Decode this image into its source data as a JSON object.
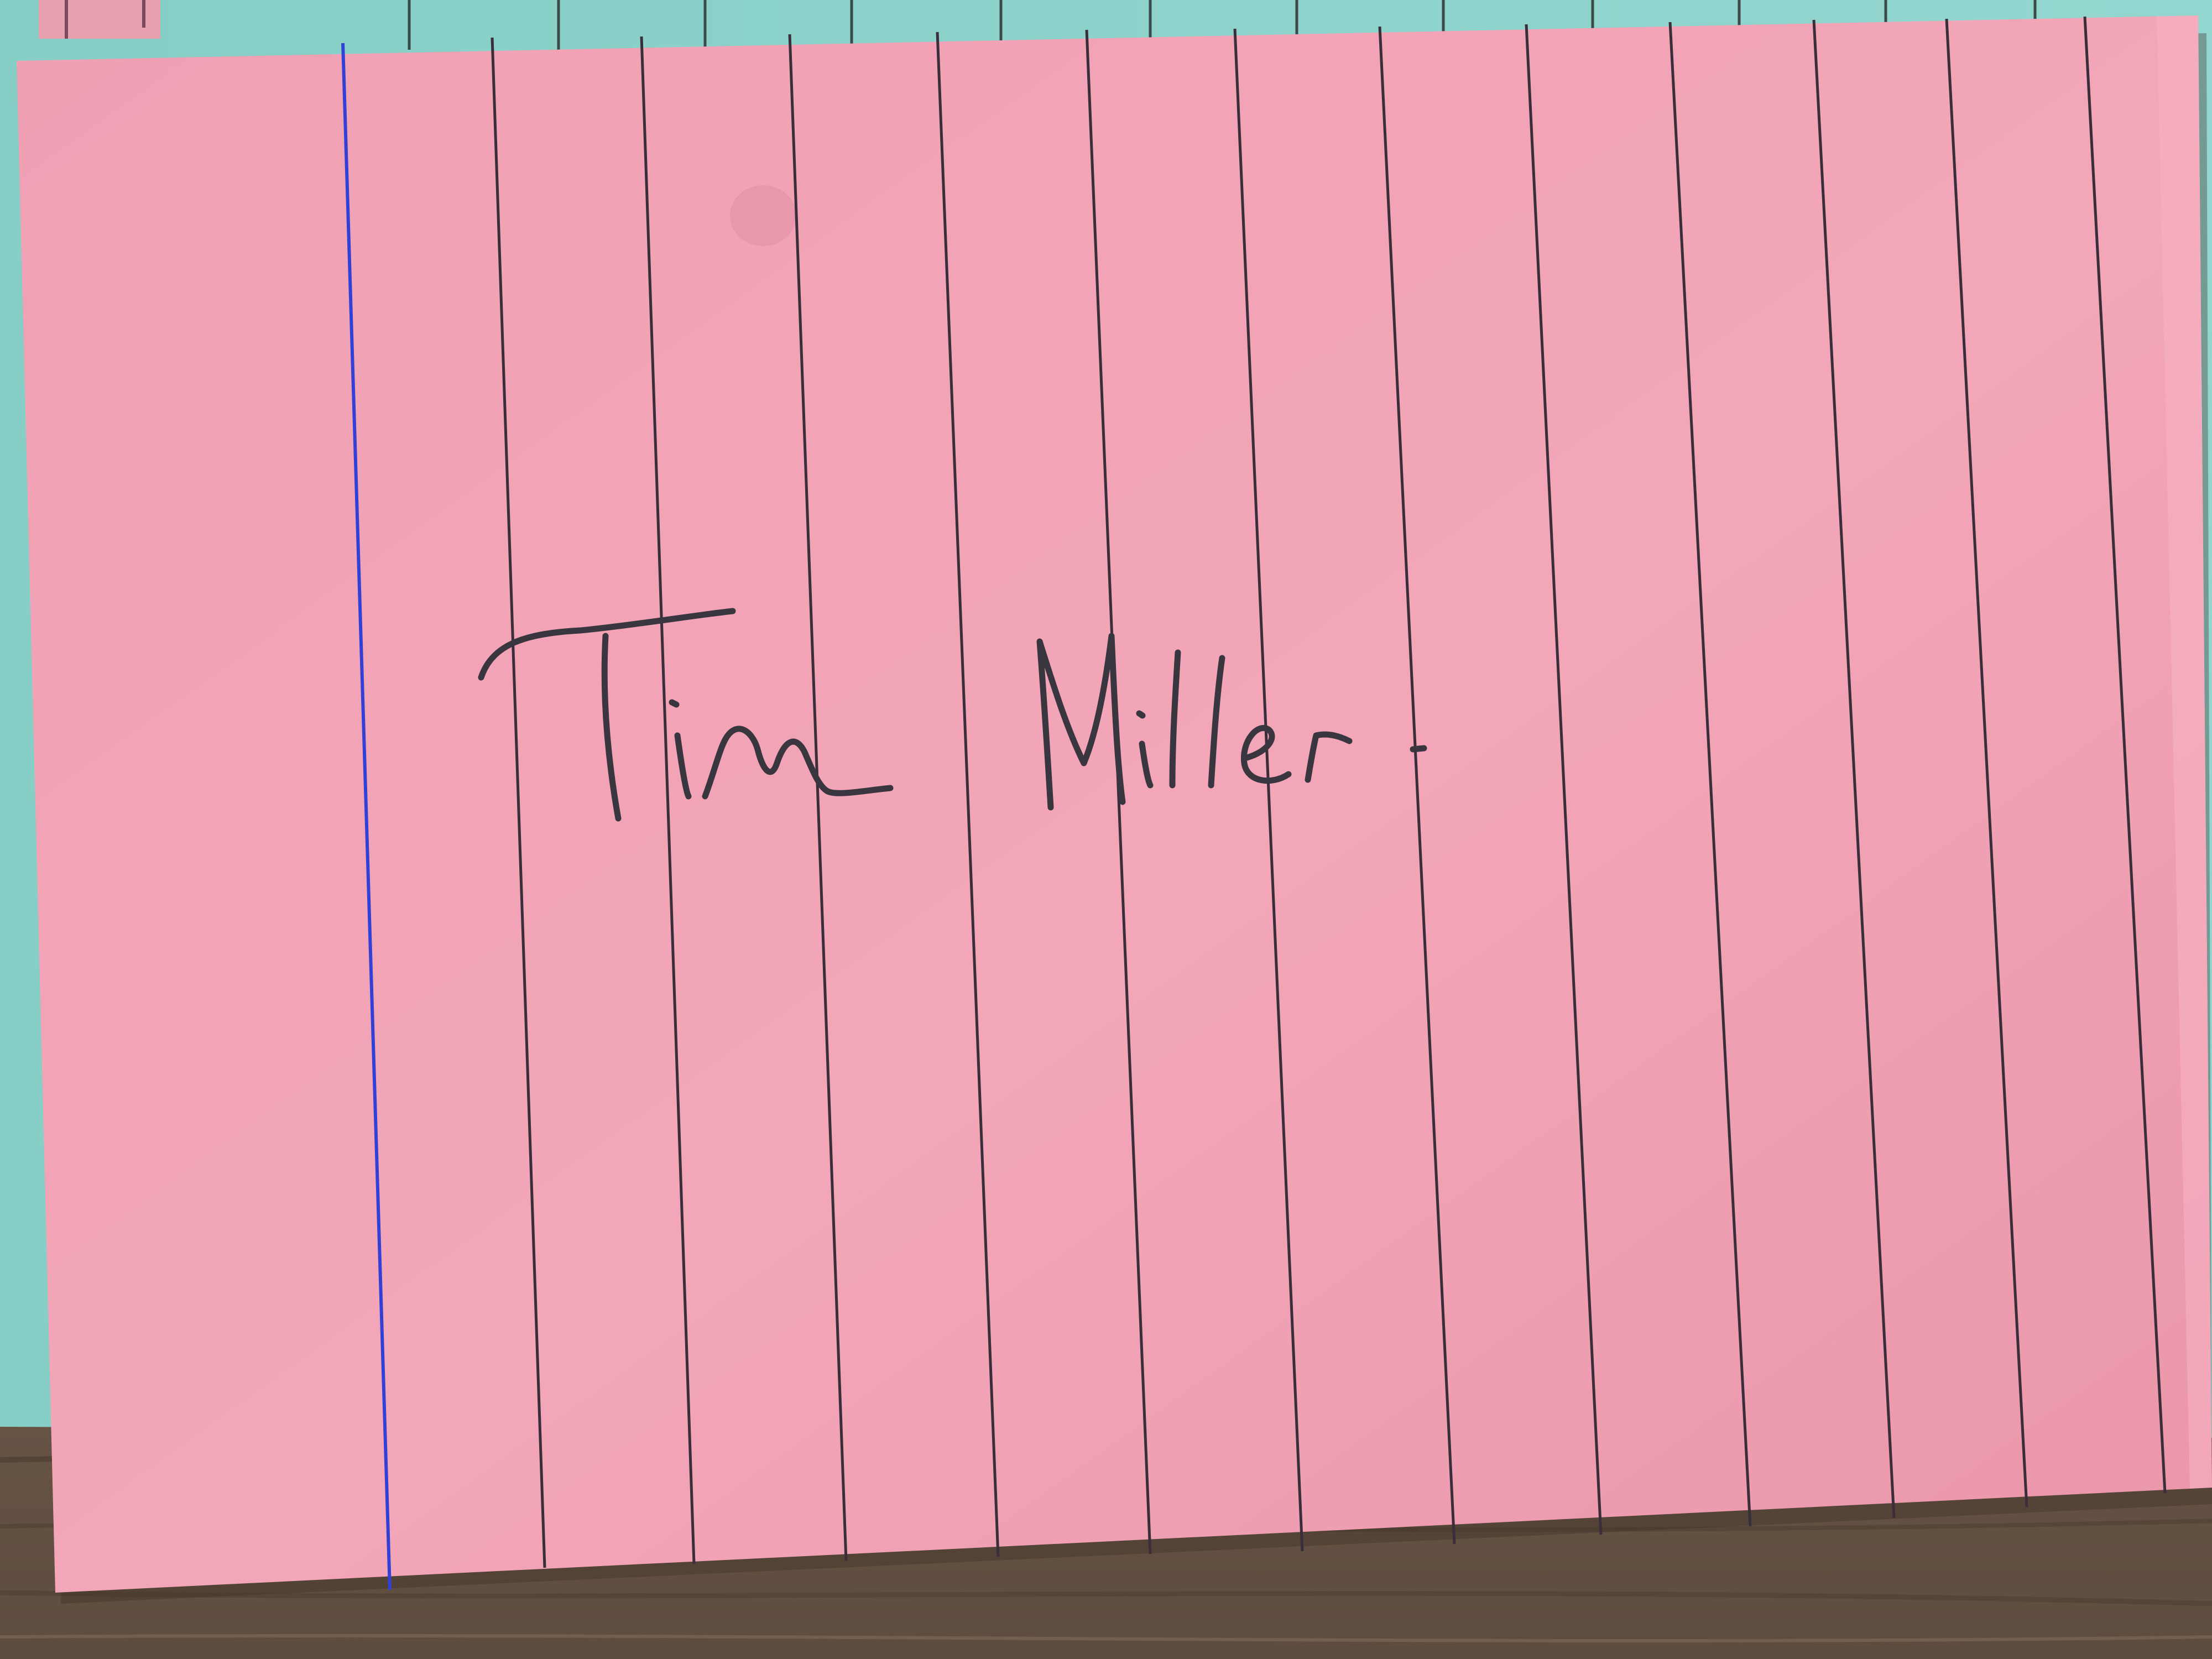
{
  "photo": {
    "subject": "index-card",
    "colors": {
      "table_wood": "#6e5b4b",
      "table_wood_dark": "#4f4034",
      "back_card": "#8ed3cc",
      "back_card_shade": "#7cc4bd",
      "card": "#f2a3b5",
      "card_shade": "#e993a7",
      "rule_line": "#3a2e3a",
      "margin_line": "#3340d6",
      "ink": "#3a3640"
    },
    "card": {
      "ruled_line_count": 12,
      "margin_line": true,
      "orientation": "rotated-portrait-ruling"
    },
    "handwriting": {
      "text": "Tim Miller",
      "style": "handwritten-signature",
      "ink_color": "#3a3640"
    }
  }
}
